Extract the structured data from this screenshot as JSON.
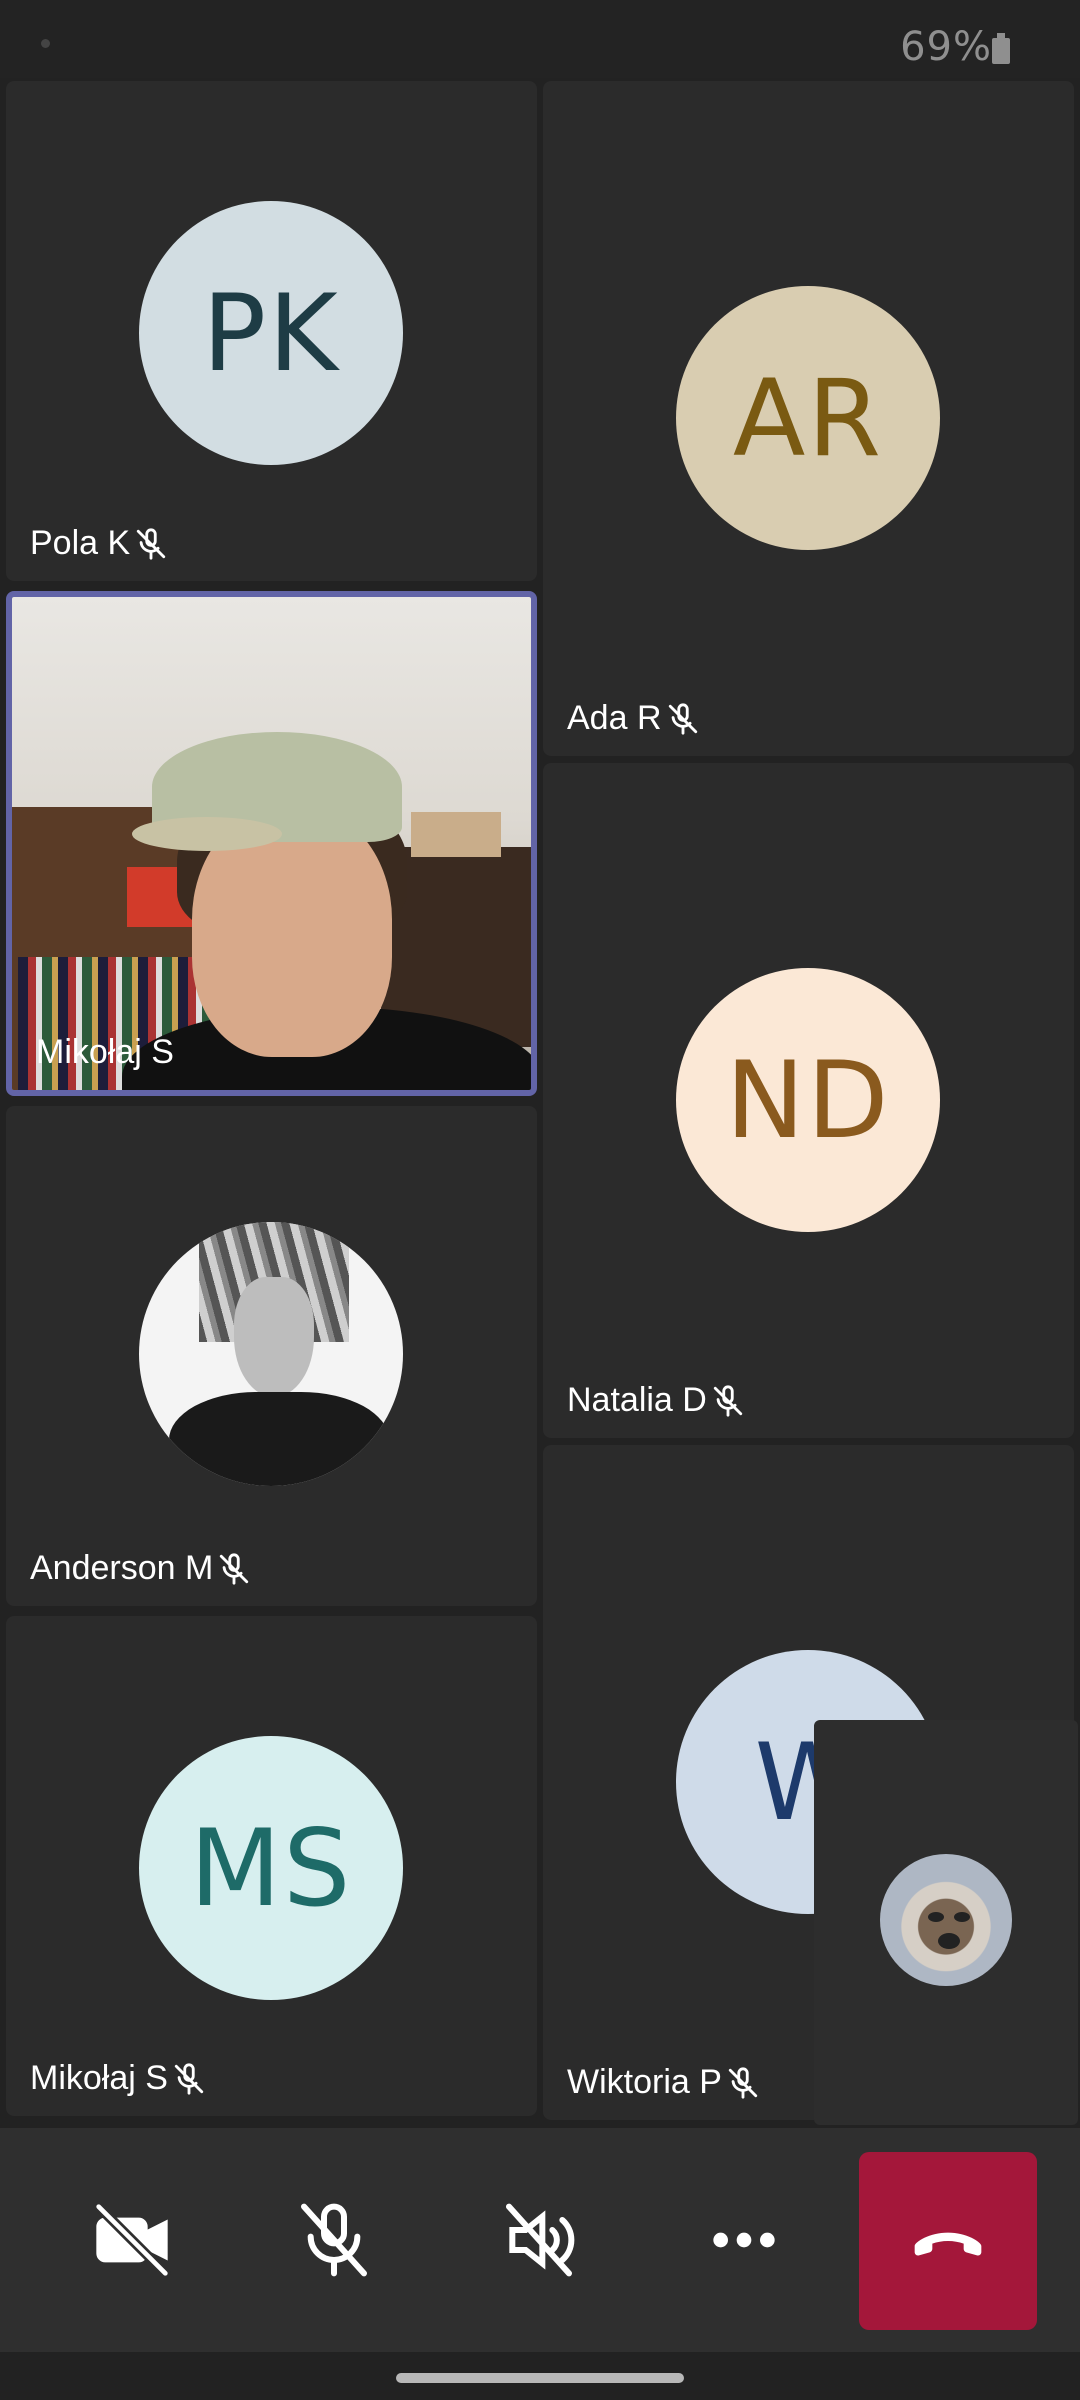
{
  "status_bar": {
    "battery": "69%"
  },
  "participants": [
    {
      "name": "Pola K",
      "initials": "PK",
      "muted": true,
      "avatar_bg": "#d2dde2",
      "initials_color": "#1e3c45"
    },
    {
      "name": "Ada R",
      "initials": "AR",
      "muted": true,
      "avatar_bg": "#d9cdb1",
      "initials_color": "#7a5a12"
    },
    {
      "name": "Mikołaj S",
      "muted": false,
      "video_on": true,
      "speaking": true
    },
    {
      "name": "Natalia D",
      "initials": "ND",
      "muted": true,
      "avatar_bg": "#fbe8d6",
      "initials_color": "#8a5a1e"
    },
    {
      "name": "Anderson M",
      "muted": true,
      "avatar_type": "image"
    },
    {
      "name": "Mikołaj S",
      "initials": "MS",
      "muted": true,
      "avatar_bg": "#d7efef",
      "initials_color": "#1e6b68"
    },
    {
      "name": "Wiktoria P",
      "initials": "W",
      "muted": true,
      "avatar_bg": "#cfdbe9",
      "initials_color": "#1d3a6b"
    }
  ],
  "self_view": {
    "avatar_type": "image",
    "icon": "reindeer-avatar"
  },
  "controls": {
    "camera": "camera-off-icon",
    "microphone": "mic-off-icon",
    "speaker": "speaker-off-icon",
    "more": "more-icon",
    "hang_up": "hang-up-icon"
  },
  "colors": {
    "speaking_border": "#6264a7",
    "end_call": "#a4173a"
  }
}
